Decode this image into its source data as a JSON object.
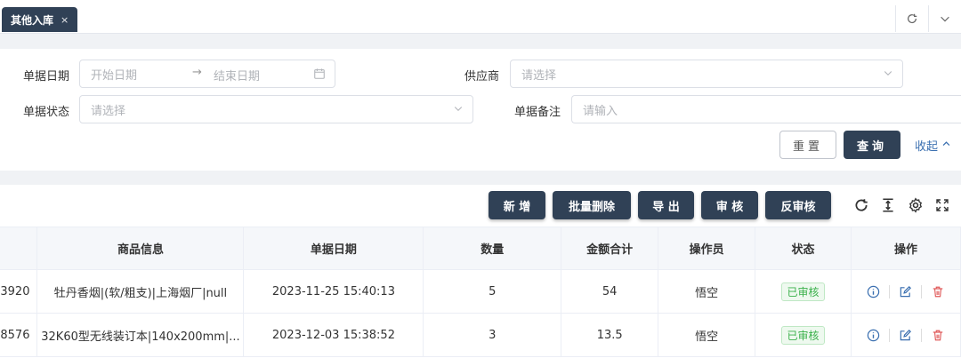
{
  "tabbar": {
    "tab_label": "其他入库",
    "close_glyph": "×"
  },
  "search": {
    "date_label": "单据日期",
    "date_start_placeholder": "开始日期",
    "date_end_placeholder": "结束日期",
    "supplier_label": "供应商",
    "supplier_placeholder": "请选择",
    "status_label": "单据状态",
    "status_placeholder": "请选择",
    "remark_label": "单据备注",
    "remark_placeholder": "请输入",
    "reset_label": "重置",
    "query_label": "查询",
    "collapse_label": "收起"
  },
  "toolbar": {
    "add_label": "新 增",
    "batch_delete_label": "批量删除",
    "export_label": "导 出",
    "audit_label": "审 核",
    "unaudit_label": "反审核"
  },
  "table": {
    "headers": [
      "商品信息",
      "单据日期",
      "数量",
      "金额合计",
      "操作员",
      "状态",
      "操作"
    ],
    "rows": [
      {
        "id_tail": "3920",
        "product": "牡丹香烟|(软/粗支)|上海烟厂|null",
        "date": "2023-11-25 15:40:13",
        "qty": "5",
        "amount": "54",
        "operator": "悟空",
        "status": "已审核"
      },
      {
        "id_tail": "8576",
        "product": "32K60型无线装订本|140x200mm|...",
        "date": "2023-12-03 15:38:52",
        "qty": "3",
        "amount": "13.5",
        "operator": "悟空",
        "status": "已审核"
      }
    ]
  },
  "colors": {
    "primary": "#304156",
    "link": "#3a6fb0",
    "success": "#3bb14b",
    "danger": "#e05a5a"
  }
}
